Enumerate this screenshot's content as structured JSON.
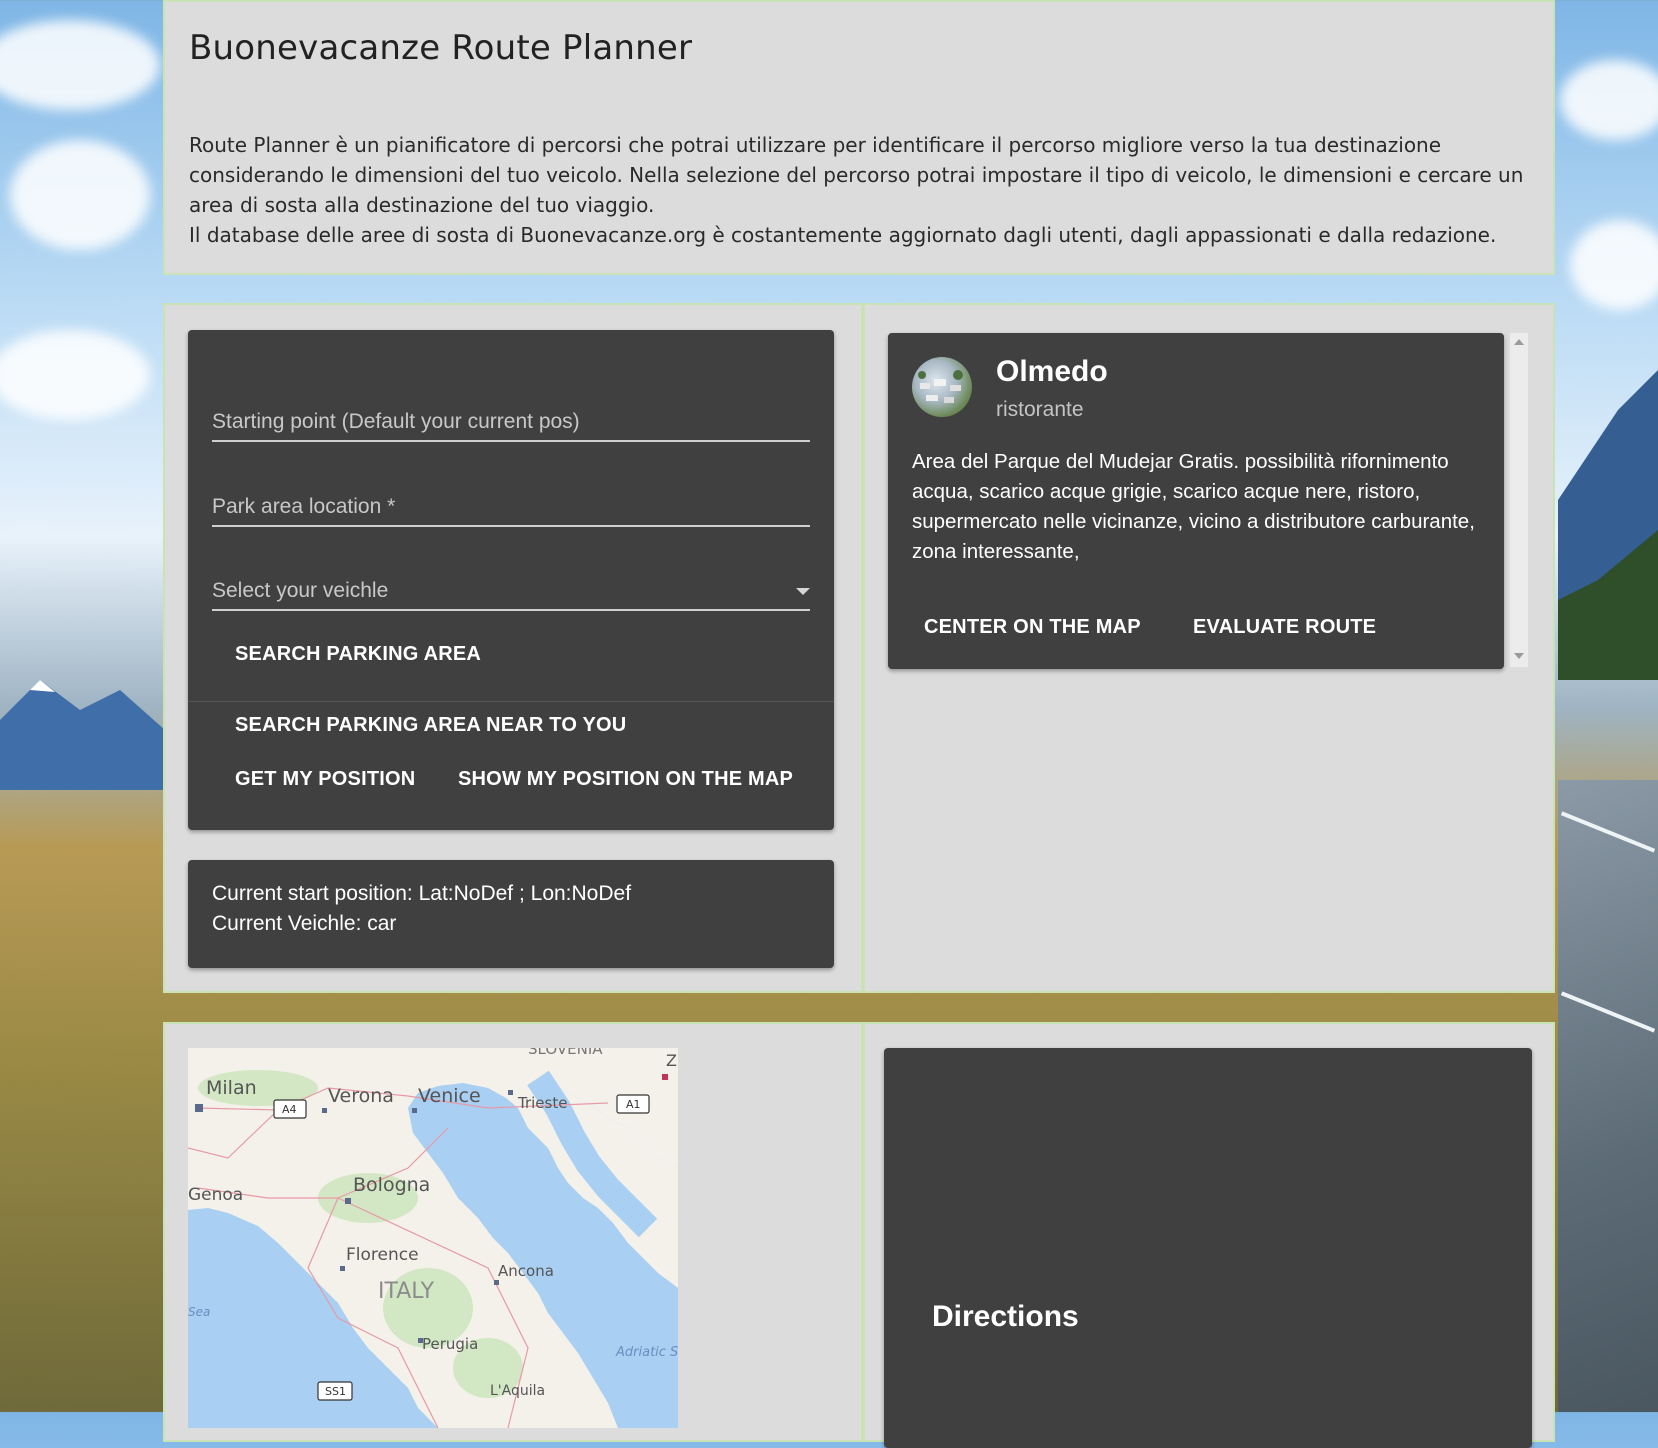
{
  "header": {
    "title": "Buonevacanze Route Planner",
    "description": "Route Planner è un pianificatore di percorsi che potrai utilizzare per identificare il percorso migliore verso la tua destinazione considerando le dimensioni del tuo veicolo. Nella selezione del percorso potrai impostare il tipo di veicolo, le dimensioni e cercare un area di sosta alla destinazione del tuo viaggio.",
    "description2": "Il database delle aree di sosta di Buonevacanze.org è costantemente aggiornato dagli utenti, dagli appassionati e dalla redazione."
  },
  "form": {
    "starting_point_placeholder": "Starting point (Default your current pos)",
    "park_area_placeholder": "Park area location *",
    "vehicle_placeholder": "Select your veichle",
    "search_button": "SEARCH PARKING AREA",
    "search_near_button": "SEARCH PARKING AREA NEAR TO YOU",
    "get_position_button": "GET MY POSITION",
    "show_position_button": "SHOW MY POSITION ON THE MAP"
  },
  "status": {
    "start_position": "Current start position: Lat:NoDef ; Lon:NoDef",
    "vehicle": "Current Veichle: car"
  },
  "results": [
    {
      "title": "Olmedo",
      "subtitle": "ristorante",
      "description": "Area del Parque del Mudejar Gratis. possibilità rifornimento acqua, scarico acque grigie, scarico acque nere, ristoro, supermercato nelle vicinanze, vicino a distributore carburante, zona interessante,",
      "center_button": "CENTER ON THE MAP",
      "evaluate_button": "EVALUATE ROUTE"
    }
  ],
  "map": {
    "labels": [
      "Milan",
      "Verona",
      "Venice",
      "Trieste",
      "Bologna",
      "Genoa",
      "Florence",
      "Ancona",
      "ITALY",
      "Perugia",
      "L'Aquila",
      "Adriatic S",
      "Sea",
      "SLOVENIA",
      "Z"
    ],
    "road_shields": [
      "A4",
      "A1",
      "SS1"
    ]
  },
  "directions": {
    "title": "Directions"
  },
  "colors": {
    "panel_bg": "#dcdcdc",
    "panel_border": "#c9e3b5",
    "card_bg": "#404040",
    "sea": "#a9cff2",
    "land": "#f4f1ea"
  }
}
